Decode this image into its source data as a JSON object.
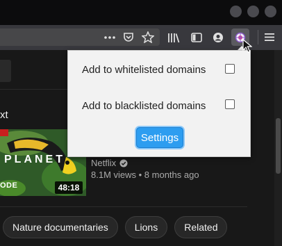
{
  "browser": {
    "toolbar_icons": [
      "more-horizontal-icon",
      "pocket-icon",
      "bookmark-star-icon",
      "library-icon",
      "sidebar-icon",
      "account-icon",
      "extension-icon",
      "hamburger-menu-icon"
    ]
  },
  "popup": {
    "whitelist_label": "Add to whitelisted domains",
    "whitelist_checked": false,
    "blacklist_label": "Add to blacklisted domains",
    "blacklist_checked": false,
    "settings_label": "Settings",
    "settings_color": "#2d9df0"
  },
  "youtube": {
    "up_next_partial": "xt",
    "video": {
      "thumb_title_partial": "PLANET",
      "thumb_corner_text_partial": "ODE",
      "duration": "48:18",
      "channel": "Netflix",
      "channel_verified": true,
      "views_and_age": "8.1M views • 8 months ago"
    },
    "chips": [
      "Nature documentaries",
      "Lions",
      "Related"
    ]
  }
}
